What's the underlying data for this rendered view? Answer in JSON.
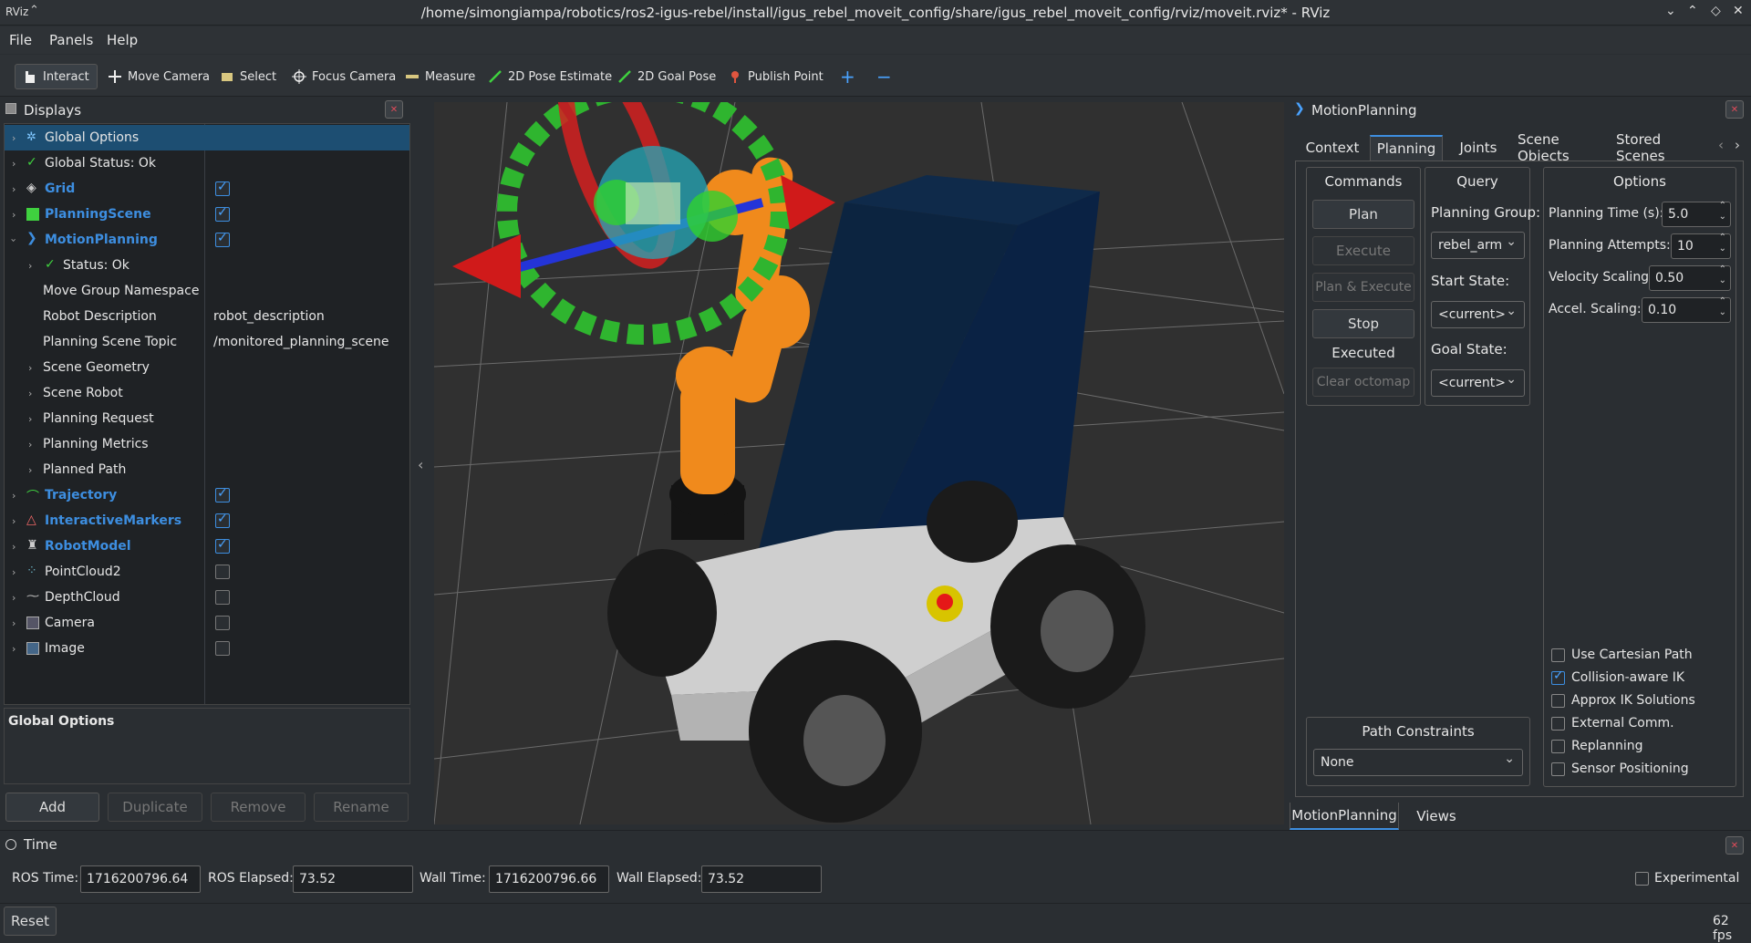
{
  "window": {
    "title": "/home/simongiampa/robotics/ros2-igus-rebel/install/igus_rebel_moveit_config/share/igus_rebel_moveit_config/rviz/moveit.rviz* - RViz",
    "logo": "RViz"
  },
  "menu": [
    "File",
    "Panels",
    "Help"
  ],
  "toolbar": {
    "interact": "Interact",
    "move_camera": "Move Camera",
    "select": "Select",
    "focus_camera": "Focus Camera",
    "measure": "Measure",
    "pose_estimate": "2D Pose Estimate",
    "goal_pose": "2D Goal Pose",
    "publish_point": "Publish Point",
    "plus": "+",
    "minus": "−"
  },
  "displays": {
    "title": "Displays",
    "rows": [
      {
        "label": "Global Options",
        "value": ""
      },
      {
        "label": "Global Status: Ok",
        "value": ""
      },
      {
        "label": "Grid",
        "value": ""
      },
      {
        "label": "PlanningScene",
        "value": ""
      },
      {
        "label": "MotionPlanning",
        "value": ""
      },
      {
        "label": "Status: Ok",
        "value": ""
      },
      {
        "label": "Move Group Namespace",
        "value": ""
      },
      {
        "label": "Robot Description",
        "value": "robot_description"
      },
      {
        "label": "Planning Scene Topic",
        "value": "/monitored_planning_scene"
      },
      {
        "label": "Scene Geometry",
        "value": ""
      },
      {
        "label": "Scene Robot",
        "value": ""
      },
      {
        "label": "Planning Request",
        "value": ""
      },
      {
        "label": "Planning Metrics",
        "value": ""
      },
      {
        "label": "Planned Path",
        "value": ""
      },
      {
        "label": "Trajectory",
        "value": ""
      },
      {
        "label": "InteractiveMarkers",
        "value": ""
      },
      {
        "label": "RobotModel",
        "value": ""
      },
      {
        "label": "PointCloud2",
        "value": ""
      },
      {
        "label": "DepthCloud",
        "value": ""
      },
      {
        "label": "Camera",
        "value": ""
      },
      {
        "label": "Image",
        "value": ""
      }
    ],
    "description_title": "Global Options",
    "buttons": {
      "add": "Add",
      "duplicate": "Duplicate",
      "remove": "Remove",
      "rename": "Rename"
    }
  },
  "motion_planning": {
    "title": "MotionPlanning",
    "tabs": [
      "Context",
      "Planning",
      "Joints",
      "Scene Objects",
      "Stored Scenes"
    ],
    "commands": {
      "title": "Commands",
      "plan": "Plan",
      "execute": "Execute",
      "plan_execute": "Plan & Execute",
      "stop": "Stop",
      "status": "Executed",
      "clear_octomap": "Clear octomap"
    },
    "query": {
      "title": "Query",
      "planning_group_label": "Planning Group:",
      "planning_group": "rebel_arm",
      "start_state_label": "Start State:",
      "start_state": "<current>",
      "goal_state_label": "Goal State:",
      "goal_state": "<current>"
    },
    "options": {
      "title": "Options",
      "planning_time_label": "Planning Time (s):",
      "planning_time": "5.0",
      "planning_attempts_label": "Planning Attempts:",
      "planning_attempts": "10",
      "velocity_scaling_label": "Velocity Scaling:",
      "velocity_scaling": "0.50",
      "accel_scaling_label": "Accel. Scaling:",
      "accel_scaling": "0.10",
      "checks": [
        {
          "label": "Use Cartesian Path",
          "checked": false
        },
        {
          "label": "Collision-aware IK",
          "checked": true
        },
        {
          "label": "Approx IK Solutions",
          "checked": false
        },
        {
          "label": "External Comm.",
          "checked": false
        },
        {
          "label": "Replanning",
          "checked": false
        },
        {
          "label": "Sensor Positioning",
          "checked": false
        }
      ]
    },
    "path_constraints": {
      "title": "Path Constraints",
      "value": "None"
    },
    "bottom_tabs": [
      "MotionPlanning",
      "Views"
    ]
  },
  "time": {
    "title": "Time",
    "ros_time_label": "ROS Time:",
    "ros_time": "1716200796.64",
    "ros_elapsed_label": "ROS Elapsed:",
    "ros_elapsed": "73.52",
    "wall_time_label": "Wall Time:",
    "wall_time": "1716200796.66",
    "wall_elapsed_label": "Wall Elapsed:",
    "wall_elapsed": "73.52",
    "experimental": "Experimental"
  },
  "status": {
    "reset": "Reset",
    "fps": "62 fps"
  },
  "colors": {
    "accent": "#3d8ee0",
    "selection": "#1d4e72",
    "robot_orange": "#f08a1c",
    "marker_green": "#2fb52f"
  }
}
